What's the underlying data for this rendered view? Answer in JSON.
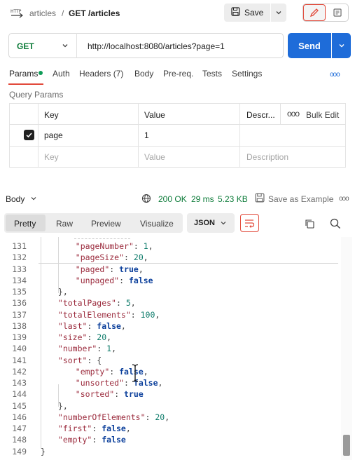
{
  "header": {
    "collection": "articles",
    "separator": "/",
    "request_title": "GET /articles",
    "save_label": "Save"
  },
  "request": {
    "method": "GET",
    "url": "http://localhost:8080/articles?page=1",
    "send_label": "Send"
  },
  "tabs": [
    {
      "label": "Params",
      "active": true
    },
    {
      "label": "Auth"
    },
    {
      "label": "Headers (7)"
    },
    {
      "label": "Body"
    },
    {
      "label": "Pre-req."
    },
    {
      "label": "Tests"
    },
    {
      "label": "Settings"
    }
  ],
  "tabs_more": "ooo",
  "query_params": {
    "title": "Query Params",
    "columns": [
      "Key",
      "Value",
      "Descr..."
    ],
    "bulk_edit_label": "Bulk Edit",
    "more_label": "ooo",
    "rows": [
      {
        "key": "page",
        "value": "1",
        "description": "",
        "checked": true
      }
    ],
    "placeholder": {
      "key": "Key",
      "value": "Value",
      "description": "Description"
    }
  },
  "response": {
    "section_label": "Body",
    "status": "200 OK",
    "time": "29 ms",
    "size": "5.23 KB",
    "save_example_label": "Save as Example",
    "more_label": "ooo",
    "view_tabs": [
      "Pretty",
      "Raw",
      "Preview",
      "Visualize"
    ],
    "active_view": "Pretty",
    "format": "JSON"
  },
  "code_lines": [
    {
      "n": "131",
      "t": [
        [
          "\"pageNumber\"",
          "k"
        ],
        [
          ": ",
          "p"
        ],
        [
          "1",
          "n"
        ],
        [
          ",",
          "p"
        ]
      ],
      "indent": 6
    },
    {
      "n": "132",
      "t": [
        [
          "\"pageSize\"",
          "k"
        ],
        [
          ": ",
          "p"
        ],
        [
          "20",
          "n"
        ],
        [
          ",",
          "p"
        ]
      ],
      "indent": 6
    },
    {
      "n": "133",
      "t": [
        [
          "\"paged\"",
          "k"
        ],
        [
          ": ",
          "p"
        ],
        [
          "true",
          "b"
        ],
        [
          ",",
          "p"
        ]
      ],
      "indent": 6
    },
    {
      "n": "134",
      "t": [
        [
          "\"unpaged\"",
          "k"
        ],
        [
          ": ",
          "p"
        ],
        [
          "false",
          "b"
        ]
      ],
      "indent": 6
    },
    {
      "n": "135",
      "t": [
        [
          "},",
          "p"
        ]
      ],
      "indent": 3
    },
    {
      "n": "136",
      "t": [
        [
          "\"totalPages\"",
          "k"
        ],
        [
          ": ",
          "p"
        ],
        [
          "5",
          "n"
        ],
        [
          ",",
          "p"
        ]
      ],
      "indent": 3
    },
    {
      "n": "137",
      "t": [
        [
          "\"totalElements\"",
          "k"
        ],
        [
          ": ",
          "p"
        ],
        [
          "100",
          "n"
        ],
        [
          ",",
          "p"
        ]
      ],
      "indent": 3
    },
    {
      "n": "138",
      "t": [
        [
          "\"last\"",
          "k"
        ],
        [
          ": ",
          "p"
        ],
        [
          "false",
          "b"
        ],
        [
          ",",
          "p"
        ]
      ],
      "indent": 3
    },
    {
      "n": "139",
      "t": [
        [
          "\"size\"",
          "k"
        ],
        [
          ": ",
          "p"
        ],
        [
          "20",
          "n"
        ],
        [
          ",",
          "p"
        ]
      ],
      "indent": 3
    },
    {
      "n": "140",
      "t": [
        [
          "\"number\"",
          "k"
        ],
        [
          ": ",
          "p"
        ],
        [
          "1",
          "n"
        ],
        [
          ",",
          "p"
        ]
      ],
      "indent": 3
    },
    {
      "n": "141",
      "t": [
        [
          "\"sort\"",
          "k"
        ],
        [
          ": {",
          "p"
        ]
      ],
      "indent": 3
    },
    {
      "n": "142",
      "t": [
        [
          "\"empty\"",
          "k"
        ],
        [
          ": ",
          "p"
        ],
        [
          "false",
          "b"
        ],
        [
          ",",
          "p"
        ]
      ],
      "indent": 6
    },
    {
      "n": "143",
      "t": [
        [
          "\"unsorted\"",
          "k"
        ],
        [
          ": ",
          "p"
        ],
        [
          "false",
          "b"
        ],
        [
          ",",
          "p"
        ]
      ],
      "indent": 6
    },
    {
      "n": "144",
      "t": [
        [
          "\"sorted\"",
          "k"
        ],
        [
          ": ",
          "p"
        ],
        [
          "true",
          "b"
        ]
      ],
      "indent": 6
    },
    {
      "n": "145",
      "t": [
        [
          "},",
          "p"
        ]
      ],
      "indent": 3
    },
    {
      "n": "146",
      "t": [
        [
          "\"numberOfElements\"",
          "k"
        ],
        [
          ": ",
          "p"
        ],
        [
          "20",
          "n"
        ],
        [
          ",",
          "p"
        ]
      ],
      "indent": 3
    },
    {
      "n": "147",
      "t": [
        [
          "\"first\"",
          "k"
        ],
        [
          ": ",
          "p"
        ],
        [
          "false",
          "b"
        ],
        [
          ",",
          "p"
        ]
      ],
      "indent": 3
    },
    {
      "n": "148",
      "t": [
        [
          "\"empty\"",
          "k"
        ],
        [
          ": ",
          "p"
        ],
        [
          "false",
          "b"
        ]
      ],
      "indent": 3
    },
    {
      "n": "149",
      "t": [
        [
          "}",
          "p"
        ]
      ],
      "indent": 0
    }
  ],
  "colors": {
    "accent": "#e24a3b",
    "send": "#1e6cd9",
    "status_ok": "#0e7c3a"
  }
}
